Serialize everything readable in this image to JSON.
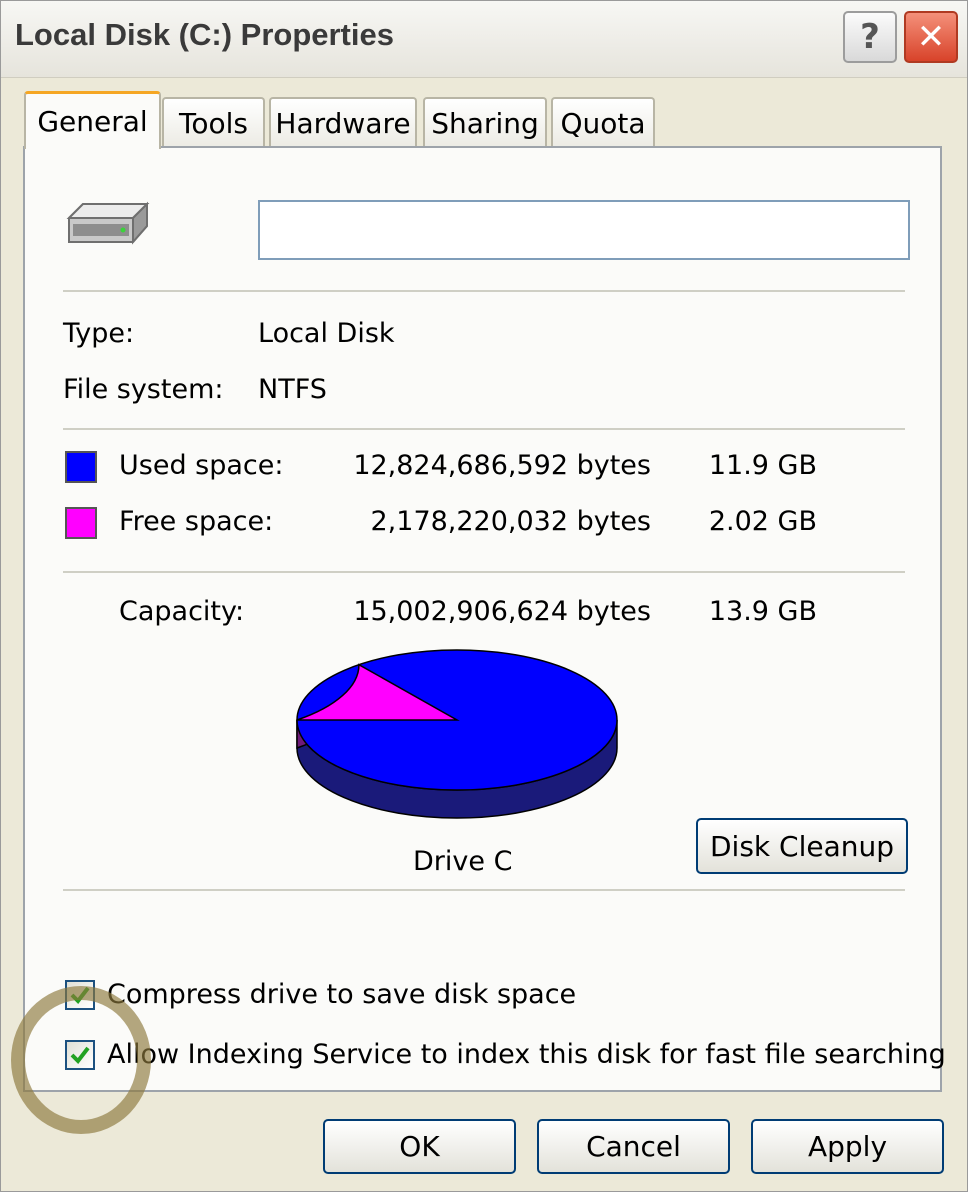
{
  "window": {
    "title": "Local Disk (C:) Properties"
  },
  "titlebar": {
    "help_glyph": "?",
    "close_glyph": "✕"
  },
  "tabs": [
    {
      "label": "General",
      "active": true
    },
    {
      "label": "Tools",
      "active": false
    },
    {
      "label": "Hardware",
      "active": false
    },
    {
      "label": "Sharing",
      "active": false
    },
    {
      "label": "Quota",
      "active": false
    }
  ],
  "general": {
    "drive_icon": "hard-drive-icon",
    "name_value": "",
    "type_label": "Type:",
    "type_value": "Local Disk",
    "fs_label": "File system:",
    "fs_value": "NTFS",
    "used": {
      "label": "Used space:",
      "bytes": "12,824,686,592 bytes",
      "size": "11.9 GB",
      "color": "#0000ff"
    },
    "free": {
      "label": "Free space:",
      "bytes": "2,178,220,032 bytes",
      "size": "2.02 GB",
      "color": "#ff00ff"
    },
    "capacity": {
      "label": "Capacity:",
      "bytes": "15,002,906,624 bytes",
      "size": "13.9 GB"
    },
    "pie": {
      "used_fraction": 0.855,
      "free_fraction": 0.145
    },
    "drive_label": "Drive C",
    "disk_cleanup_label": "Disk Cleanup",
    "compress": {
      "label": "Compress drive to save disk space",
      "checked": true
    },
    "indexing": {
      "label": "Allow Indexing Service to index this disk for fast file searching",
      "checked": true
    }
  },
  "footer": {
    "ok_label": "OK",
    "cancel_label": "Cancel",
    "apply_label": "Apply"
  }
}
